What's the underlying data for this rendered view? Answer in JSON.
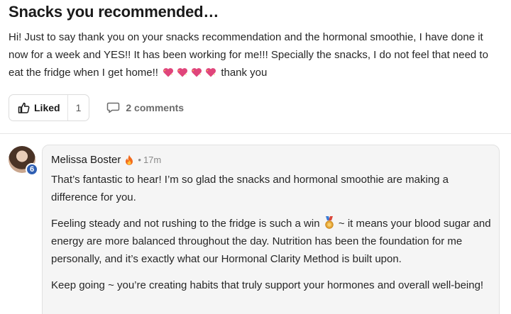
{
  "post": {
    "title": "Snacks you recommended…",
    "body_text": "Hi! Just to say thank you on your snacks recommendation and the hormonal smoothie, I have done it now for a week and YES!! It has been working for me!!! Specially the snacks, I do not feel that need to eat the fridge when I get home!! ",
    "body_tail": "thank you",
    "heart_emoji_count": 4,
    "heart_color": "#e0457b"
  },
  "actions": {
    "like_label": "Liked",
    "like_count": "1",
    "comments_label": "2 comments"
  },
  "comment": {
    "author": "Melissa Boster",
    "author_level": "6",
    "time": "17m",
    "paragraphs": {
      "p1": "That’s fantastic to hear! I’m so glad the snacks and hormonal smoothie are making a difference for you.",
      "p2a": "Feeling steady and not rushing to the fridge is such a win ",
      "p2b": " ~ it means your blood sugar and energy are more balanced throughout the day. Nutrition has been the foundation for me personally, and it’s exactly what our Hormonal Clarity Method is built upon.",
      "p3": "Keep going ~ you’re creating habits that truly support your hormones and overall well-being!"
    }
  }
}
